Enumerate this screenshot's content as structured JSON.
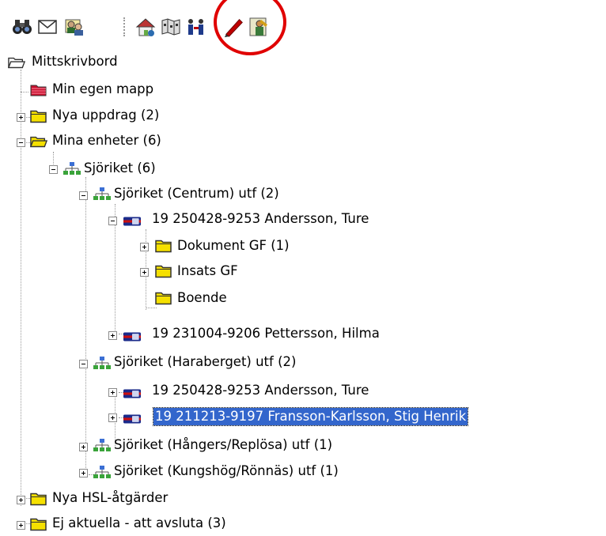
{
  "toolbar": {
    "buttons": [
      {
        "icon": "binoculars-icon"
      },
      {
        "icon": "envelope-icon"
      },
      {
        "icon": "users-icon"
      },
      {
        "icon": "house-icon"
      },
      {
        "icon": "map-icon"
      },
      {
        "icon": "people-icon"
      },
      {
        "icon": "pen-icon"
      },
      {
        "icon": "person-document-icon"
      }
    ]
  },
  "tree": {
    "root": "Mittskrivbord",
    "min_egen_mapp": "Min egen mapp",
    "nya_uppdrag": "Nya uppdrag (2)",
    "mina_enheter": "Mina enheter (6)",
    "sjoriket": "Sjöriket (6)",
    "centrum": "Sjöriket (Centrum) utf (2)",
    "person_andersson_1": "19 250428-9253 Andersson, Ture",
    "dokument_gf": "Dokument GF (1)",
    "insats_gf": "Insats GF",
    "boende": "Boende",
    "person_pettersson": "19 231004-9206 Pettersson, Hilma",
    "haraberget": "Sjöriket (Haraberget) utf (2)",
    "person_andersson_2": "19 250428-9253 Andersson, Ture",
    "person_fransson": "19 211213-9197 Fransson-Karlsson, Stig Henrik",
    "hangers": "Sjöriket (Hångers/Replösa) utf (1)",
    "kungshog": "Sjöriket (Kungshög/Rönnäs) utf (1)",
    "nya_hsl": "Nya HSL-åtgärder",
    "ej_aktuella": "Ej aktuella - att avsluta (3)"
  },
  "colors": {
    "selection": "#3366cc",
    "folder": "#f5e000",
    "annotation": "#e00000"
  }
}
